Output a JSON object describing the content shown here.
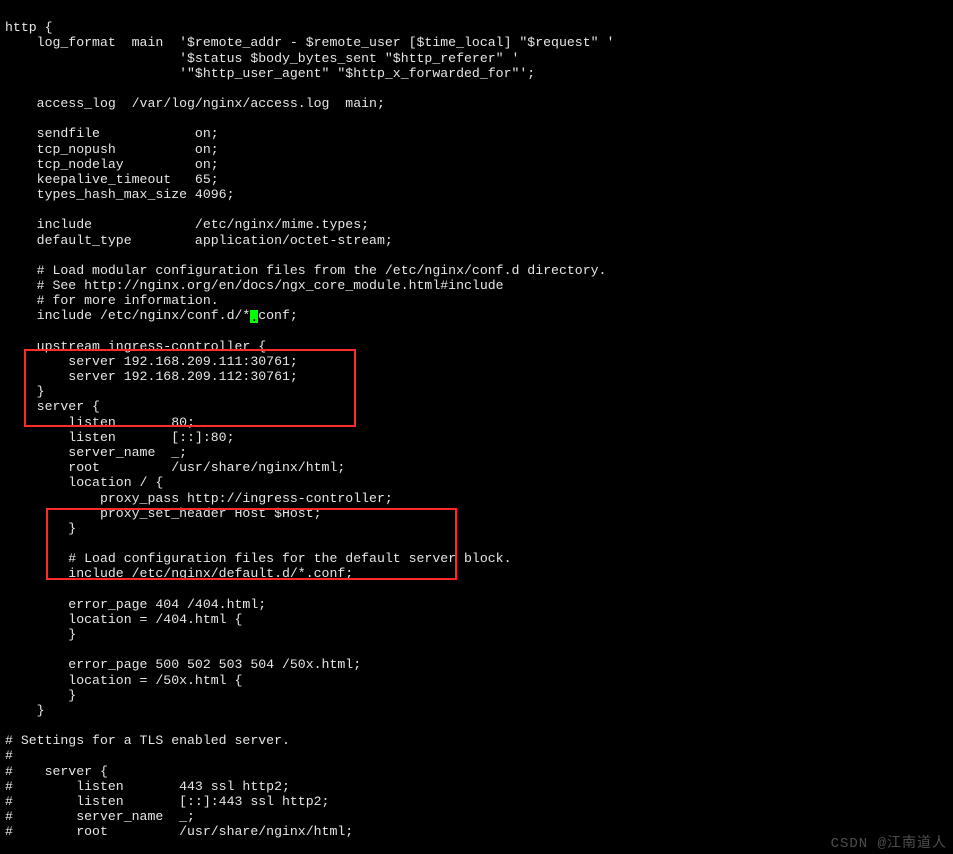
{
  "lines": {
    "l0": "http {",
    "l1": "    log_format  main  '$remote_addr - $remote_user [$time_local] \"$request\" '",
    "l2": "                      '$status $body_bytes_sent \"$http_referer\" '",
    "l3": "                      '\"$http_user_agent\" \"$http_x_forwarded_for\"';",
    "l4": "",
    "l5": "    access_log  /var/log/nginx/access.log  main;",
    "l6": "",
    "l7": "    sendfile            on;",
    "l8": "    tcp_nopush          on;",
    "l9": "    tcp_nodelay         on;",
    "l10": "    keepalive_timeout   65;",
    "l11": "    types_hash_max_size 4096;",
    "l12": "",
    "l13": "    include             /etc/nginx/mime.types;",
    "l14": "    default_type        application/octet-stream;",
    "l15": "",
    "l16": "    # Load modular configuration files from the /etc/nginx/conf.d directory.",
    "l17": "    # See http://nginx.org/en/docs/ngx_core_module.html#include",
    "l18": "    # for more information.",
    "l19a": "    include /etc/nginx/conf.d/*",
    "l19b": "conf;",
    "l20": "",
    "l21": "    upstream ingress-controller {",
    "l22": "        server 192.168.209.111:30761;",
    "l23": "        server 192.168.209.112:30761;",
    "l24": "    }",
    "l25": "    server {",
    "l26": "        listen       80;",
    "l27": "        listen       [::]:80;",
    "l28": "        server_name  _;",
    "l29": "        root         /usr/share/nginx/html;",
    "l30": "        location / {",
    "l31": "            proxy_pass http://ingress-controller;",
    "l32": "            proxy_set_header Host $Host;",
    "l33": "        }",
    "l34": "",
    "l35": "        # Load configuration files for the default server block.",
    "l36": "        include /etc/nginx/default.d/*.conf;",
    "l37": "",
    "l38": "        error_page 404 /404.html;",
    "l39": "        location = /404.html {",
    "l40": "        }",
    "l41": "",
    "l42": "        error_page 500 502 503 504 /50x.html;",
    "l43": "        location = /50x.html {",
    "l44": "        }",
    "l45": "    }",
    "l46": "",
    "l47": "# Settings for a TLS enabled server.",
    "l48": "#",
    "l49": "#    server {",
    "l50": "#        listen       443 ssl http2;",
    "l51": "#        listen       [::]:443 ssl http2;",
    "l52": "#        server_name  _;",
    "l53": "#        root         /usr/share/nginx/html;"
  },
  "cursor_char": ".",
  "watermark": "CSDN @江南道人"
}
